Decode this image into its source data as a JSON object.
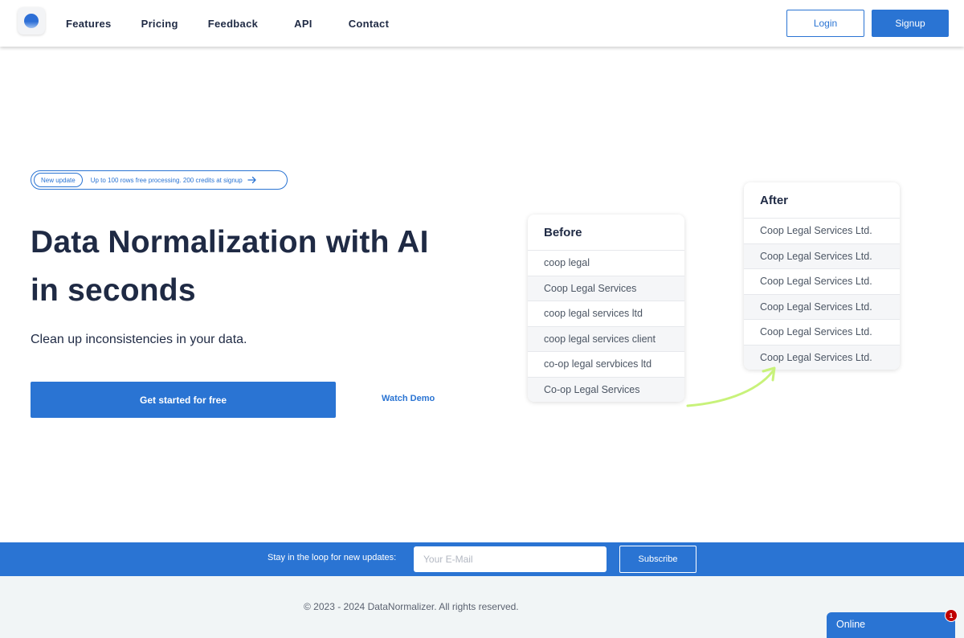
{
  "nav": {
    "items": [
      {
        "label": "Features"
      },
      {
        "label": "Pricing"
      },
      {
        "label": "Feedback"
      },
      {
        "label": "API"
      },
      {
        "label": "Contact"
      }
    ],
    "login_label": "Login",
    "signup_label": "Signup"
  },
  "hero": {
    "update_tag": "New update",
    "update_text": "Up to 100 rows free processing. 200 credits at signup",
    "title_line1": "Data Normalization with AI",
    "title_line2": "in seconds",
    "subtitle": "Clean up inconsistencies in your data.",
    "cta_label": "Get started for free",
    "demo_label": "Watch Demo"
  },
  "before": {
    "title": "Before",
    "rows": [
      "coop legal",
      "Coop Legal Services",
      "coop legal services ltd",
      "coop legal services client",
      "co-op legal servbices ltd",
      "Co-op Legal Services"
    ]
  },
  "after": {
    "title": "After",
    "rows": [
      "Coop Legal Services Ltd.",
      "Coop Legal Services Ltd.",
      "Coop Legal Services Ltd.",
      "Coop Legal Services Ltd.",
      "Coop Legal Services Ltd.",
      "Coop Legal Services Ltd."
    ]
  },
  "newsletter": {
    "label": "Stay in the loop for new updates:",
    "placeholder": "Your E-Mail",
    "button_label": "Subscribe"
  },
  "footer": {
    "copyright": "© 2023 - 2024 DataNormalizer. All rights reserved."
  },
  "chat": {
    "label": "Online",
    "badge": "1"
  },
  "colors": {
    "accent": "#2a74d3",
    "text": "#1f2a44",
    "arrow": "#c8f27a",
    "badge": "#c00000",
    "footer_bg": "#f1f5f6"
  },
  "icons": {
    "logo": "logo-ball-icon",
    "update_arrow": "arrow-right-icon",
    "transform_arrow": "curved-arrow-icon"
  }
}
